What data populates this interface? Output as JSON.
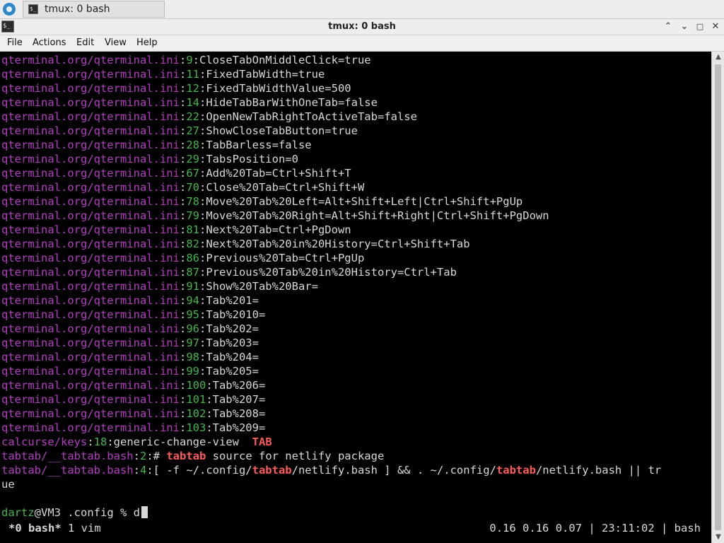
{
  "taskbar": {
    "task_label": "tmux: 0 bash"
  },
  "window": {
    "title": "tmux: 0 bash"
  },
  "menu": [
    {
      "label": "File"
    },
    {
      "label": "Actions"
    },
    {
      "label": "Edit"
    },
    {
      "label": "View"
    },
    {
      "label": "Help"
    }
  ],
  "terminal": {
    "lines": [
      [
        {
          "t": "qterminal.org/qterminal.ini",
          "c": "m"
        },
        {
          "t": ":",
          "c": "w"
        },
        {
          "t": "9",
          "c": "g"
        },
        {
          "t": ":CloseTabOnMiddleClick=true",
          "c": "w"
        }
      ],
      [
        {
          "t": "qterminal.org/qterminal.ini",
          "c": "m"
        },
        {
          "t": ":",
          "c": "w"
        },
        {
          "t": "11",
          "c": "g"
        },
        {
          "t": ":FixedTabWidth=true",
          "c": "w"
        }
      ],
      [
        {
          "t": "qterminal.org/qterminal.ini",
          "c": "m"
        },
        {
          "t": ":",
          "c": "w"
        },
        {
          "t": "12",
          "c": "g"
        },
        {
          "t": ":FixedTabWidthValue=500",
          "c": "w"
        }
      ],
      [
        {
          "t": "qterminal.org/qterminal.ini",
          "c": "m"
        },
        {
          "t": ":",
          "c": "w"
        },
        {
          "t": "14",
          "c": "g"
        },
        {
          "t": ":HideTabBarWithOneTab=false",
          "c": "w"
        }
      ],
      [
        {
          "t": "qterminal.org/qterminal.ini",
          "c": "m"
        },
        {
          "t": ":",
          "c": "w"
        },
        {
          "t": "22",
          "c": "g"
        },
        {
          "t": ":OpenNewTabRightToActiveTab=false",
          "c": "w"
        }
      ],
      [
        {
          "t": "qterminal.org/qterminal.ini",
          "c": "m"
        },
        {
          "t": ":",
          "c": "w"
        },
        {
          "t": "27",
          "c": "g"
        },
        {
          "t": ":ShowCloseTabButton=true",
          "c": "w"
        }
      ],
      [
        {
          "t": "qterminal.org/qterminal.ini",
          "c": "m"
        },
        {
          "t": ":",
          "c": "w"
        },
        {
          "t": "28",
          "c": "g"
        },
        {
          "t": ":TabBarless=false",
          "c": "w"
        }
      ],
      [
        {
          "t": "qterminal.org/qterminal.ini",
          "c": "m"
        },
        {
          "t": ":",
          "c": "w"
        },
        {
          "t": "29",
          "c": "g"
        },
        {
          "t": ":TabsPosition=0",
          "c": "w"
        }
      ],
      [
        {
          "t": "qterminal.org/qterminal.ini",
          "c": "m"
        },
        {
          "t": ":",
          "c": "w"
        },
        {
          "t": "67",
          "c": "g"
        },
        {
          "t": ":Add%20Tab=Ctrl+Shift+T",
          "c": "w"
        }
      ],
      [
        {
          "t": "qterminal.org/qterminal.ini",
          "c": "m"
        },
        {
          "t": ":",
          "c": "w"
        },
        {
          "t": "70",
          "c": "g"
        },
        {
          "t": ":Close%20Tab=Ctrl+Shift+W",
          "c": "w"
        }
      ],
      [
        {
          "t": "qterminal.org/qterminal.ini",
          "c": "m"
        },
        {
          "t": ":",
          "c": "w"
        },
        {
          "t": "78",
          "c": "g"
        },
        {
          "t": ":Move%20Tab%20Left=Alt+Shift+Left|Ctrl+Shift+PgUp",
          "c": "w"
        }
      ],
      [
        {
          "t": "qterminal.org/qterminal.ini",
          "c": "m"
        },
        {
          "t": ":",
          "c": "w"
        },
        {
          "t": "79",
          "c": "g"
        },
        {
          "t": ":Move%20Tab%20Right=Alt+Shift+Right|Ctrl+Shift+PgDown",
          "c": "w"
        }
      ],
      [
        {
          "t": "qterminal.org/qterminal.ini",
          "c": "m"
        },
        {
          "t": ":",
          "c": "w"
        },
        {
          "t": "81",
          "c": "g"
        },
        {
          "t": ":Next%20Tab=Ctrl+PgDown",
          "c": "w"
        }
      ],
      [
        {
          "t": "qterminal.org/qterminal.ini",
          "c": "m"
        },
        {
          "t": ":",
          "c": "w"
        },
        {
          "t": "82",
          "c": "g"
        },
        {
          "t": ":Next%20Tab%20in%20History=Ctrl+Shift+Tab",
          "c": "w"
        }
      ],
      [
        {
          "t": "qterminal.org/qterminal.ini",
          "c": "m"
        },
        {
          "t": ":",
          "c": "w"
        },
        {
          "t": "86",
          "c": "g"
        },
        {
          "t": ":Previous%20Tab=Ctrl+PgUp",
          "c": "w"
        }
      ],
      [
        {
          "t": "qterminal.org/qterminal.ini",
          "c": "m"
        },
        {
          "t": ":",
          "c": "w"
        },
        {
          "t": "87",
          "c": "g"
        },
        {
          "t": ":Previous%20Tab%20in%20History=Ctrl+Tab",
          "c": "w"
        }
      ],
      [
        {
          "t": "qterminal.org/qterminal.ini",
          "c": "m"
        },
        {
          "t": ":",
          "c": "w"
        },
        {
          "t": "91",
          "c": "g"
        },
        {
          "t": ":Show%20Tab%20Bar=",
          "c": "w"
        }
      ],
      [
        {
          "t": "qterminal.org/qterminal.ini",
          "c": "m"
        },
        {
          "t": ":",
          "c": "w"
        },
        {
          "t": "94",
          "c": "g"
        },
        {
          "t": ":Tab%201=",
          "c": "w"
        }
      ],
      [
        {
          "t": "qterminal.org/qterminal.ini",
          "c": "m"
        },
        {
          "t": ":",
          "c": "w"
        },
        {
          "t": "95",
          "c": "g"
        },
        {
          "t": ":Tab%2010=",
          "c": "w"
        }
      ],
      [
        {
          "t": "qterminal.org/qterminal.ini",
          "c": "m"
        },
        {
          "t": ":",
          "c": "w"
        },
        {
          "t": "96",
          "c": "g"
        },
        {
          "t": ":Tab%202=",
          "c": "w"
        }
      ],
      [
        {
          "t": "qterminal.org/qterminal.ini",
          "c": "m"
        },
        {
          "t": ":",
          "c": "w"
        },
        {
          "t": "97",
          "c": "g"
        },
        {
          "t": ":Tab%203=",
          "c": "w"
        }
      ],
      [
        {
          "t": "qterminal.org/qterminal.ini",
          "c": "m"
        },
        {
          "t": ":",
          "c": "w"
        },
        {
          "t": "98",
          "c": "g"
        },
        {
          "t": ":Tab%204=",
          "c": "w"
        }
      ],
      [
        {
          "t": "qterminal.org/qterminal.ini",
          "c": "m"
        },
        {
          "t": ":",
          "c": "w"
        },
        {
          "t": "99",
          "c": "g"
        },
        {
          "t": ":Tab%205=",
          "c": "w"
        }
      ],
      [
        {
          "t": "qterminal.org/qterminal.ini",
          "c": "m"
        },
        {
          "t": ":",
          "c": "w"
        },
        {
          "t": "100",
          "c": "g"
        },
        {
          "t": ":Tab%206=",
          "c": "w"
        }
      ],
      [
        {
          "t": "qterminal.org/qterminal.ini",
          "c": "m"
        },
        {
          "t": ":",
          "c": "w"
        },
        {
          "t": "101",
          "c": "g"
        },
        {
          "t": ":Tab%207=",
          "c": "w"
        }
      ],
      [
        {
          "t": "qterminal.org/qterminal.ini",
          "c": "m"
        },
        {
          "t": ":",
          "c": "w"
        },
        {
          "t": "102",
          "c": "g"
        },
        {
          "t": ":Tab%208=",
          "c": "w"
        }
      ],
      [
        {
          "t": "qterminal.org/qterminal.ini",
          "c": "m"
        },
        {
          "t": ":",
          "c": "w"
        },
        {
          "t": "103",
          "c": "g"
        },
        {
          "t": ":Tab%209=",
          "c": "w"
        }
      ],
      [
        {
          "t": "calcurse/keys",
          "c": "m"
        },
        {
          "t": ":",
          "c": "w"
        },
        {
          "t": "18",
          "c": "g"
        },
        {
          "t": ":generic-change-view  ",
          "c": "w"
        },
        {
          "t": "TAB",
          "c": "r"
        }
      ],
      [
        {
          "t": "tabtab/__tabtab.bash",
          "c": "m"
        },
        {
          "t": ":",
          "c": "w"
        },
        {
          "t": "2",
          "c": "g"
        },
        {
          "t": ":# ",
          "c": "w"
        },
        {
          "t": "tabtab",
          "c": "r"
        },
        {
          "t": " source for netlify package",
          "c": "w"
        }
      ],
      [
        {
          "t": "tabtab/__tabtab.bash",
          "c": "m"
        },
        {
          "t": ":",
          "c": "w"
        },
        {
          "t": "4",
          "c": "g"
        },
        {
          "t": ":[ -f ~/.config/",
          "c": "w"
        },
        {
          "t": "tabtab",
          "c": "r"
        },
        {
          "t": "/netlify.bash ] && . ~/.config/",
          "c": "w"
        },
        {
          "t": "tabtab",
          "c": "r"
        },
        {
          "t": "/netlify.bash || tr",
          "c": "w"
        }
      ],
      [
        {
          "t": "ue",
          "c": "w"
        }
      ],
      [],
      [
        {
          "t": "dartz",
          "c": "g"
        },
        {
          "t": "@VM3 .config % d",
          "c": "w"
        }
      ]
    ],
    "status_left_active": "*0 bash*",
    "status_left_rest": " 1 vim",
    "status_right": "0.16 0.16 0.07 | 23:11:02 | bash"
  }
}
